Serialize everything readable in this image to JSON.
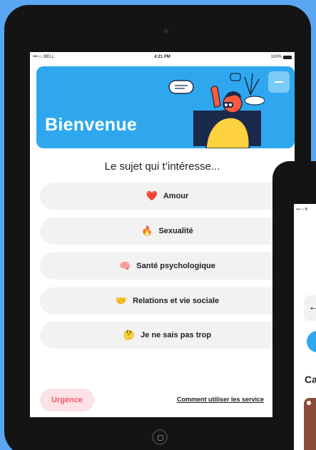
{
  "status_bar": {
    "carrier": "•••○○ BELL",
    "time": "4:21 PM",
    "battery": "100%"
  },
  "banner": {
    "title": "Bienvenue",
    "bg_color": "#2ea7ef"
  },
  "subtitle": "Le sujet qui t’intéresse...",
  "topics": [
    {
      "icon": "heart-icon",
      "emoji": "❤️",
      "label": "Amour"
    },
    {
      "icon": "fire-icon",
      "emoji": "🔥",
      "label": "Sexualité"
    },
    {
      "icon": "brain-icon",
      "emoji": "🧠",
      "label": "Santé psychologique"
    },
    {
      "icon": "handshake-icon",
      "emoji": "🤝",
      "label": "Relations et vie sociale"
    },
    {
      "icon": "thinking-face-icon",
      "emoji": "🤔",
      "label": "Je ne sais pas trop"
    }
  ],
  "footer": {
    "urgence_label": "Urgence",
    "howto_label": "Comment utiliser les service"
  },
  "second_device": {
    "status": "•••○○ B",
    "back_glyph": "←",
    "partial_text": "Ca"
  },
  "colors": {
    "accent": "#2ea7ef",
    "urgence_text": "#ee5a73",
    "urgence_bg": "#fde1e4",
    "page_bg": "#5aa6f2"
  }
}
